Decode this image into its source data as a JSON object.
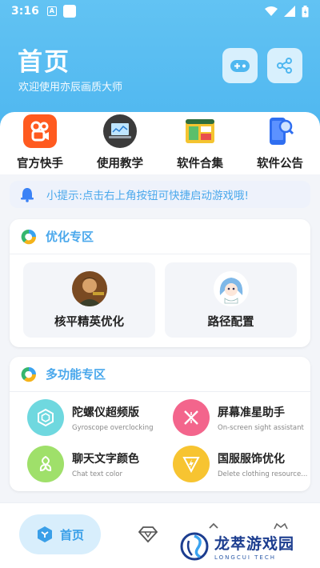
{
  "status_bar": {
    "time": "3:16",
    "notif_letter": "A"
  },
  "header": {
    "title": "首页",
    "subtitle": "欢迎使用亦辰画质大师"
  },
  "header_buttons": [
    {
      "name": "gamepad-icon"
    },
    {
      "name": "share-icon"
    }
  ],
  "categories": [
    {
      "label": "官方快手",
      "icon": "kuaishou-icon"
    },
    {
      "label": "使用教学",
      "icon": "laptop-icon"
    },
    {
      "label": "软件合集",
      "icon": "app-window-icon"
    },
    {
      "label": "软件公告",
      "icon": "phone-search-icon"
    }
  ],
  "tip": {
    "text": "小提示:点击右上角按钮可快捷启动游戏哦!"
  },
  "optimize_zone": {
    "title": "优化专区",
    "items": [
      {
        "label": "核平精英优化"
      },
      {
        "label": "路径配置"
      }
    ]
  },
  "multi_zone": {
    "title": "多功能专区",
    "items": [
      {
        "title": "陀螺仪超频版",
        "subtitle": "Gyroscope overclocking",
        "color": "#6fd8df"
      },
      {
        "title": "屏幕准星助手",
        "subtitle": "On-screen sight assistant",
        "color": "#f3658c"
      },
      {
        "title": "聊天文字颜色",
        "subtitle": "Chat text color",
        "color": "#9fe06a"
      },
      {
        "title": "国服服饰优化",
        "subtitle": "Delete clothing resource...",
        "color": "#f7c431"
      }
    ]
  },
  "bottom_nav": {
    "home_label": "首页"
  },
  "watermark": {
    "title": "龙萃游戏园",
    "subtitle": "LONGCUI TECH"
  },
  "colors": {
    "accent": "#4fb7f0",
    "accent_text": "#4aa8ec"
  }
}
